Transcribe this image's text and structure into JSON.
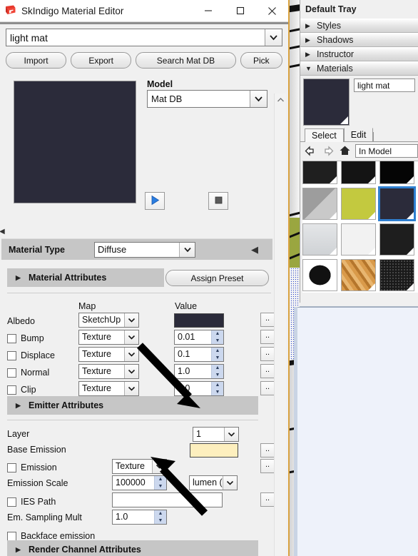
{
  "window": {
    "title": "SkIndigo Material Editor",
    "icon": "sketchup-icon",
    "minimize": "—",
    "maximize": "☐",
    "close": "✕"
  },
  "material_combo": {
    "value": "light mat",
    "arrow": "chevron-down-icon"
  },
  "toolbar": {
    "import": "Import",
    "export": "Export",
    "search": "Search Mat DB",
    "pick": "Pick"
  },
  "preview": {
    "swatch_color": "#2b2b3a",
    "model_label": "Model",
    "model_value": "Mat DB",
    "play_icon": "play-icon",
    "stop_icon": "stop-icon"
  },
  "material_type": {
    "label": "Material Type",
    "value": "Diffuse",
    "collapse_icon": "triangle-left-icon"
  },
  "material_attributes": {
    "title": "Material Attributes",
    "expander": "▶",
    "assign_preset": "Assign Preset",
    "col_map": "Map",
    "col_value": "Value",
    "browse_label": "..",
    "rows": [
      {
        "name": "Albedo",
        "checkbox": false,
        "map": "SketchUp",
        "value_type": "color",
        "color": "#2b2b3a"
      },
      {
        "name": "Bump",
        "checkbox": true,
        "map": "Texture",
        "value_type": "spin",
        "value": "0.01"
      },
      {
        "name": "Displace",
        "checkbox": true,
        "map": "Texture",
        "value_type": "spin",
        "value": "0.1"
      },
      {
        "name": "Normal",
        "checkbox": true,
        "map": "Texture",
        "value_type": "spin",
        "value": "1.0"
      },
      {
        "name": "Clip",
        "checkbox": true,
        "map": "Texture",
        "value_type": "spin",
        "value": "1.0"
      }
    ]
  },
  "emitter_attributes": {
    "title": "Emitter Attributes",
    "expander": "▶",
    "layer_label": "Layer",
    "layer_value": "1",
    "base_emission_label": "Base Emission",
    "base_emission_color": "#fdefbe",
    "emission_label": "Emission",
    "emission_map": "Texture",
    "emission_scale_label": "Emission Scale",
    "emission_scale_value": "100000",
    "emission_unit": "lumen (lm",
    "ies_path_label": "IES Path",
    "ies_path_value": "",
    "sampling_label": "Em. Sampling Mult",
    "sampling_value": "1.0",
    "backface_label": "Backface emission",
    "browse_label": ".."
  },
  "render_channel": {
    "title": "Render Channel Attributes",
    "expander": "▶"
  },
  "scrollbar": {
    "up_icon": "chevron-up-icon"
  },
  "tray": {
    "title": "Default Tray",
    "items": [
      {
        "label": "Styles",
        "expanded": false
      },
      {
        "label": "Shadows",
        "expanded": false
      },
      {
        "label": "Instructor",
        "expanded": false
      },
      {
        "label": "Materials",
        "expanded": true
      }
    ],
    "material_name": "light mat",
    "material_thumb_color": "#2b2b3a",
    "tabs": [
      {
        "label": "Select",
        "active": true
      },
      {
        "label": "Edit",
        "active": false
      }
    ],
    "nav": {
      "back_icon": "arrow-left-icon",
      "forward_icon": "arrow-right-icon",
      "home_icon": "home-icon",
      "collection": "In Model"
    },
    "swatches": [
      {
        "color": "#1f1f1f",
        "selected": false
      },
      {
        "color": "#141414",
        "selected": false
      },
      {
        "color": "#050505",
        "selected": false
      },
      {
        "color": "#e2e2e2",
        "selected": false
      },
      {
        "color": "#8e8e8e",
        "selected": false
      },
      {
        "color": "#c3c93f",
        "selected": false
      },
      {
        "color": "#2b2b3a",
        "selected": true
      },
      {
        "color": "#6e6e6e",
        "selected": false
      },
      {
        "color": "#d6d8da",
        "selected": false
      },
      {
        "color": "#f2f2f2",
        "selected": false
      },
      {
        "color": "#1e1e1e",
        "selected": false
      },
      {
        "color": "#e6e9ec",
        "selected": false
      },
      {
        "color": "#ffffff",
        "selected": false
      },
      {
        "color": "#c98a3c",
        "selected": false
      },
      {
        "color": "#2a2a2a",
        "selected": false
      },
      {
        "color": "#ccd6dd",
        "selected": false
      }
    ]
  }
}
